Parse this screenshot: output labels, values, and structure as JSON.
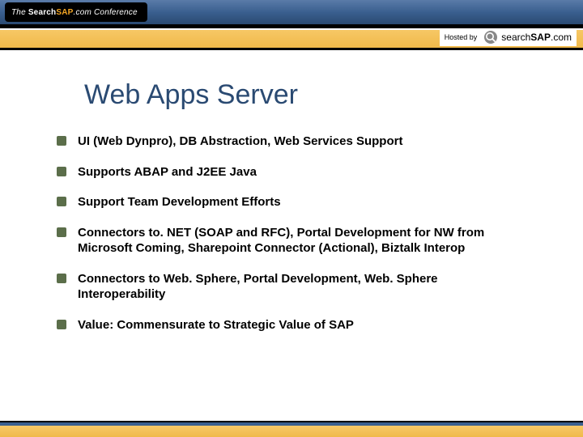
{
  "header": {
    "logo_prefix": "The ",
    "logo_search": "Search",
    "logo_sap": "SAP",
    "logo_com": ".com",
    "logo_suffix": " Conference"
  },
  "hosted": {
    "label": "Hosted by",
    "logo_search": "search",
    "logo_sap": "SAP",
    "logo_com": ".com"
  },
  "slide": {
    "title": "Web Apps Server",
    "bullets": [
      "UI (Web Dynpro), DB Abstraction, Web Services Support",
      "Supports ABAP and J2EE Java",
      "Support Team Development Efforts",
      "Connectors to. NET (SOAP and RFC), Portal Development for NW from Microsoft Coming, Sharepoint Connector (Actional), Biztalk Interop",
      "Connectors to Web. Sphere, Portal Development, Web. Sphere Interoperability",
      "Value: Commensurate to Strategic Value of SAP"
    ]
  }
}
